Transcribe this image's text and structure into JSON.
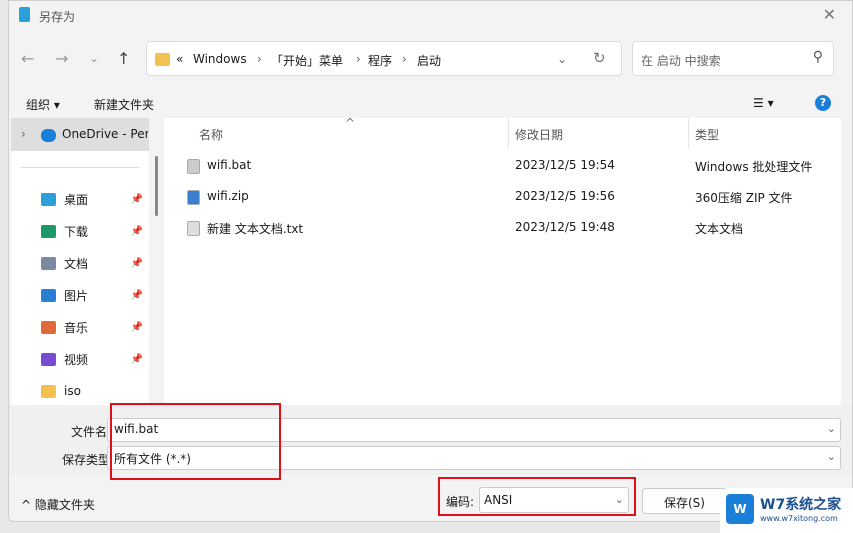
{
  "window": {
    "title": "另存为",
    "close": "✕"
  },
  "nav": {
    "back": "←",
    "forward": "→",
    "recent": "⌄",
    "up": "↑"
  },
  "address": {
    "overflow": "«",
    "crumbs": [
      "Windows",
      "「开始」菜单",
      "程序",
      "启动"
    ],
    "sep": "›",
    "dropdown": "⌄",
    "refresh": "↻"
  },
  "search": {
    "placeholder": "在 启动 中搜索",
    "icon": "⚲"
  },
  "toolbar": {
    "organize": "组织 ▾",
    "new_folder": "新建文件夹",
    "view": "☰ ▾",
    "help": "?"
  },
  "sidebar": {
    "onedrive": "OneDrive - Per",
    "items": [
      {
        "label": "桌面",
        "icon": "desktop-icon",
        "color": "#2a9fd8"
      },
      {
        "label": "下载",
        "icon": "download-icon",
        "color": "#1a9a6a"
      },
      {
        "label": "文档",
        "icon": "document-icon",
        "color": "#7a8aa0"
      },
      {
        "label": "图片",
        "icon": "pictures-icon",
        "color": "#2a7fd0"
      },
      {
        "label": "音乐",
        "icon": "music-icon",
        "color": "#e06a3a"
      },
      {
        "label": "视频",
        "icon": "video-icon",
        "color": "#7a4ad0"
      },
      {
        "label": "iso",
        "icon": "folder-icon",
        "color": "#f2c14e"
      }
    ]
  },
  "columns": {
    "name": "名称",
    "modified": "修改日期",
    "type": "类型"
  },
  "files": [
    {
      "name": "wifi.bat",
      "modified": "2023/12/5 19:54",
      "type": "Windows 批处理文件",
      "color": "#ccc"
    },
    {
      "name": "wifi.zip",
      "modified": "2023/12/5 19:56",
      "type": "360压缩 ZIP 文件",
      "color": "#3a7fd0"
    },
    {
      "name": "新建 文本文档.txt",
      "modified": "2023/12/5 19:48",
      "type": "文本文档",
      "color": "#ddd"
    }
  ],
  "form": {
    "filename_label": "文件名(N):",
    "filename": "wifi.bat",
    "type_label": "保存类型(T):",
    "type": "所有文件 (*.*)",
    "encoding_label": "编码:",
    "encoding": "ANSI",
    "save": "保存(S)",
    "hide_folders": "^ 隐藏文件夹"
  },
  "watermark": {
    "brand": "W7系统之家",
    "url": "www.w7xitong.com"
  }
}
